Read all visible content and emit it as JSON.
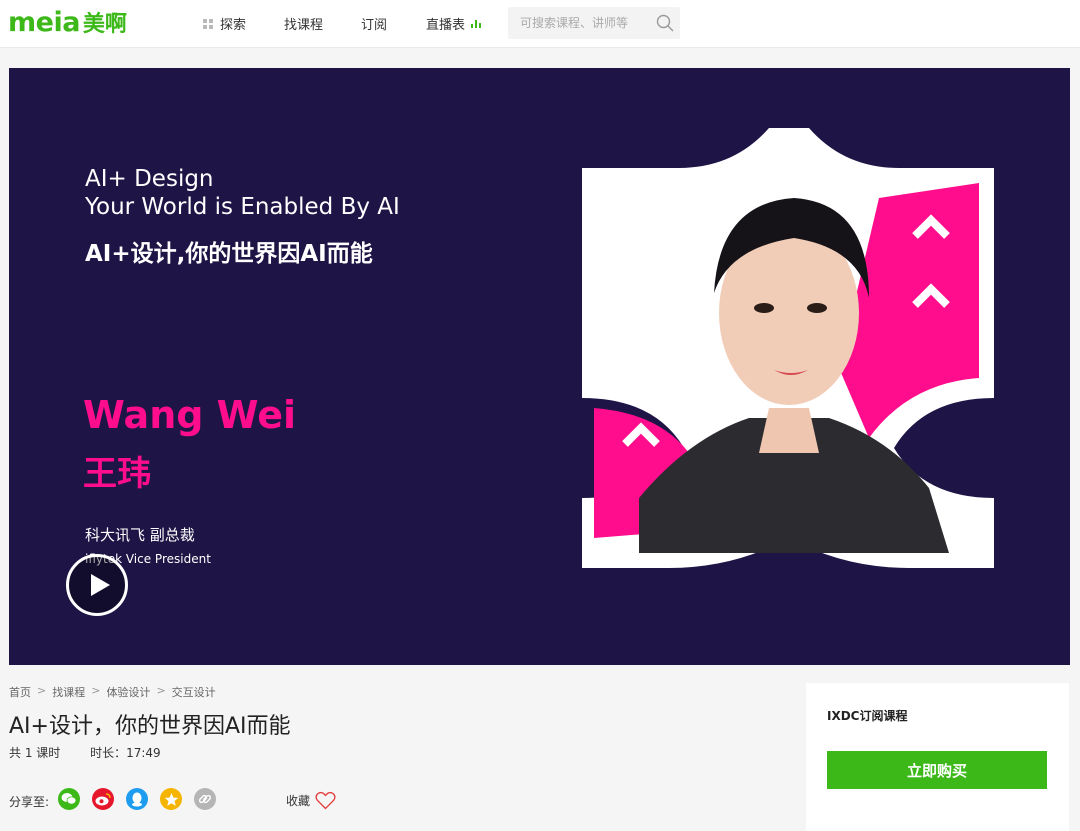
{
  "header": {
    "logo_latin": "meia",
    "logo_cjk": "美啊",
    "nav": {
      "explore": "探索",
      "find_course": "找课程",
      "subscribe": "订阅",
      "live_schedule": "直播表"
    },
    "search": {
      "placeholder": "可搜索课程、讲师等"
    }
  },
  "banner": {
    "title_en_line1": "AI+ Design",
    "title_en_line2": "Your World is Enabled By AI",
    "title_cn": "AI+设计,你的世界因AI而能",
    "speaker_name_en": "Wang Wei",
    "speaker_name_cn": "王玮",
    "speaker_role_cn": "科大讯飞 副总裁",
    "speaker_role_en": "iflytek Vice President",
    "colors": {
      "background": "#1e1446",
      "accent": "#ff0d8c"
    }
  },
  "breadcrumb": [
    "首页",
    "找课程",
    "体验设计",
    "交互设计"
  ],
  "breadcrumb_separator": ">",
  "course": {
    "title": "AI+设计，你的世界因AI而能",
    "lessons": "共 1 课时",
    "duration": "时长：17:49"
  },
  "share": {
    "label": "分享至:",
    "icons": [
      "wechat-icon",
      "weibo-icon",
      "qq-icon",
      "qzone-icon",
      "link-icon"
    ]
  },
  "favorite": {
    "label": "收藏"
  },
  "side_panel": {
    "title": "IXDC订阅课程",
    "buy_label": "立即购买",
    "accent": "#3cb919"
  }
}
